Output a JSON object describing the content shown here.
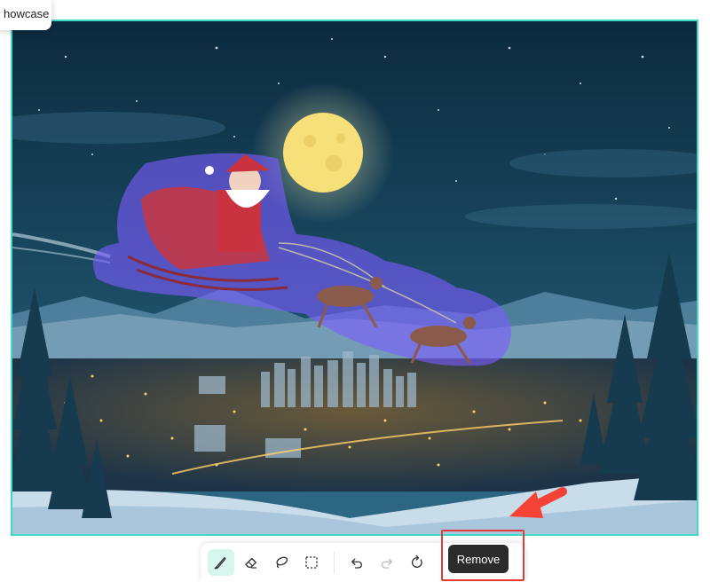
{
  "tooltip": {
    "text": "howcase"
  },
  "toolbar": {
    "tools": [
      {
        "icon": "brush-icon",
        "active": true
      },
      {
        "icon": "eraser-icon"
      },
      {
        "icon": "lasso-icon"
      },
      {
        "icon": "rect-select-icon"
      },
      {
        "icon": "undo-icon"
      },
      {
        "icon": "redo-icon"
      },
      {
        "icon": "reset-icon"
      }
    ],
    "remove_label": "Remove"
  },
  "colors": {
    "selection_border": "#3fd9c4",
    "brush_active_bg": "#d6f6ee",
    "remove_button": "#2b2b2b",
    "highlight_box": "#e53935",
    "mask": "#7a5cff"
  }
}
